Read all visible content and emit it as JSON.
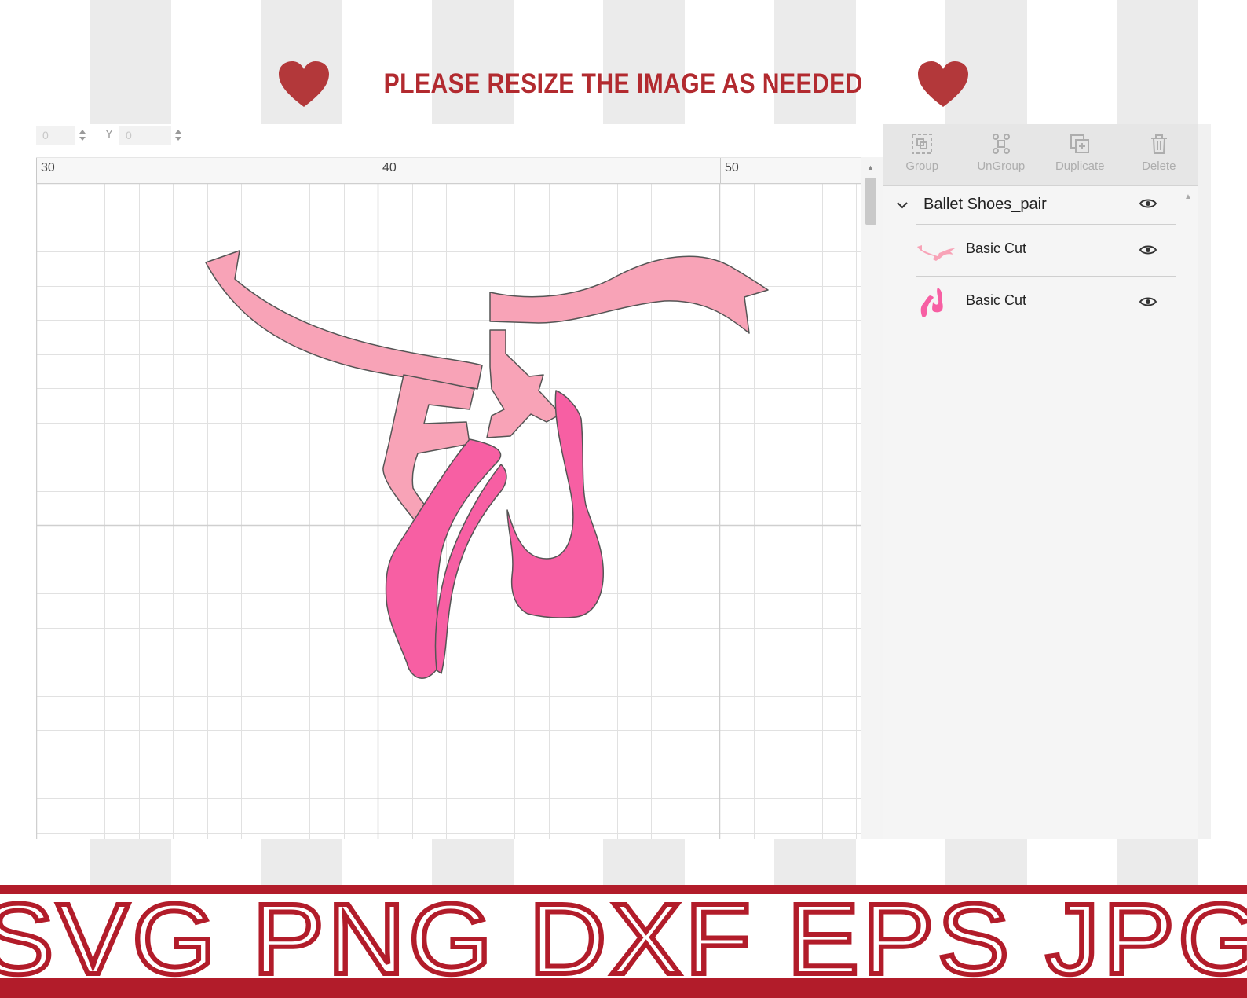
{
  "banner": {
    "text": "PLEASE RESIZE THE IMAGE AS NEEDED",
    "heart_icon": "heart-icon",
    "color": "#b22a2f"
  },
  "position": {
    "x_value": "0",
    "y_label": "Y",
    "y_value": "0"
  },
  "ruler": {
    "labels": [
      "30",
      "40",
      "50"
    ]
  },
  "toolbar": {
    "items": [
      {
        "label": "Group",
        "icon": "group-icon"
      },
      {
        "label": "UnGroup",
        "icon": "ungroup-icon"
      },
      {
        "label": "Duplicate",
        "icon": "duplicate-icon"
      },
      {
        "label": "Delete",
        "icon": "trash-icon"
      }
    ]
  },
  "layers": {
    "group": {
      "name": "Ballet Shoes_pair",
      "icon": "chevron-down-icon",
      "visibility_icon": "eye-icon"
    },
    "items": [
      {
        "label": "Basic Cut",
        "thumbnail": "ribbon-thumbnail",
        "visibility_icon": "eye-icon"
      },
      {
        "label": "Basic Cut",
        "thumbnail": "shoes-thumbnail",
        "visibility_icon": "eye-icon"
      }
    ]
  },
  "artwork": {
    "ribbon_color": "#f8a3b7",
    "shoe_color": "#f75fa3",
    "outline_color": "#555555"
  },
  "formats": {
    "text": "SVG PNG DXF EPS JPG",
    "color": "#b21c2a"
  }
}
